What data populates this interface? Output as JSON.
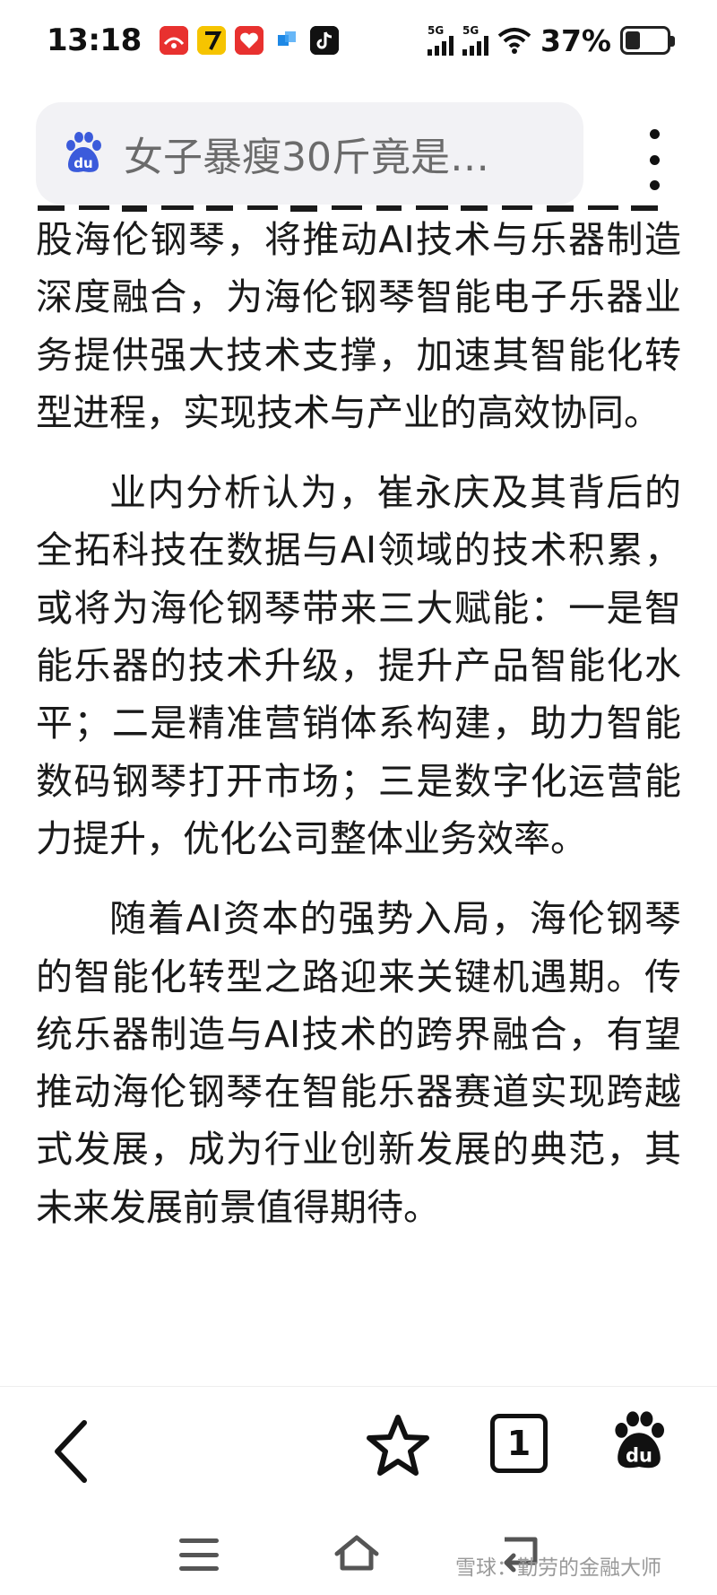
{
  "status_bar": {
    "time": "13:18",
    "network_1": "5G",
    "network_2": "5G",
    "battery_percent": "37%",
    "battery_level": 0.37,
    "notification_icons": [
      "app-icon-red",
      "app-icon-yellow-7",
      "app-icon-red-heart",
      "app-icon-blue",
      "tiktok-icon"
    ]
  },
  "header": {
    "search_query": "女子暴瘦30斤竟是…",
    "more_icon": "more-vertical-icon",
    "logo_icon": "baidu-paw-icon"
  },
  "article": {
    "paragraphs": [
      "股海伦钢琴，将推动AI技术与乐器制造深度融合，为海伦钢琴智能电子乐器业务提供强大技术支撑，加速其智能化转型进程，实现技术与产业的高效协同。",
      "业内分析认为，崔永庆及其背后的全拓科技在数据与AI领域的技术积累，或将为海伦钢琴带来三大赋能：一是智能乐器的技术升级，提升产品智能化水平；二是精准营销体系构建，助力智能数码钢琴打开市场；三是数字化运营能力提升，优化公司整体业务效率。",
      "随着AI资本的强势入局，海伦钢琴的智能化转型之路迎来关键机遇期。传统乐器制造与AI技术的跨界融合，有望推动海伦钢琴在智能乐器赛道实现跨越式发展，成为行业创新发展的典范，其未来发展前景值得期待。"
    ]
  },
  "toolbar": {
    "back_icon": "chevron-left-icon",
    "bookmark_icon": "star-icon",
    "tab_count": "1",
    "home_icon": "baidu-paw-icon"
  },
  "system_nav": {
    "menu_icon": "menu-icon",
    "home_icon": "home-icon",
    "back_icon": "back-arrow-icon"
  },
  "watermark": "雪球：勤劳的金融大师"
}
